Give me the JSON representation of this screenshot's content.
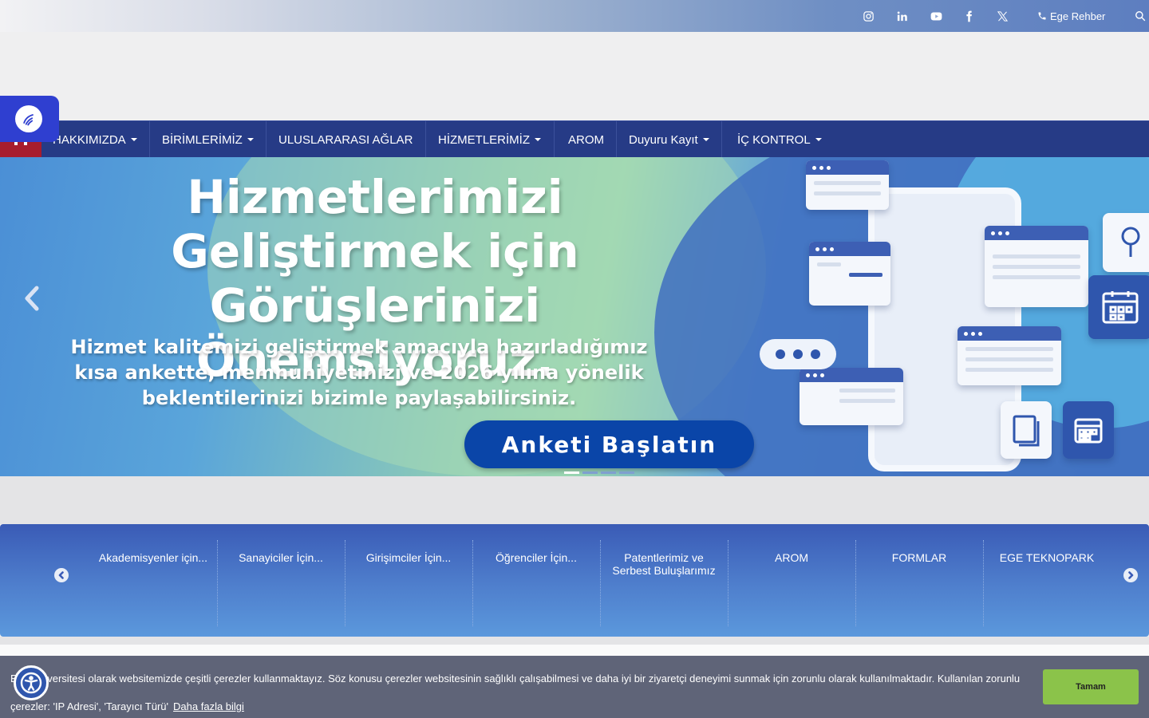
{
  "topbar": {
    "social": [
      {
        "icon": "instagram-icon"
      },
      {
        "icon": "linkedin-icon"
      },
      {
        "icon": "youtube-icon"
      },
      {
        "icon": "facebook-icon"
      },
      {
        "icon": "x-twitter-icon"
      }
    ],
    "rehber_label": "Ege Rehber",
    "search_icon": "search-icon"
  },
  "nav": {
    "items": [
      {
        "label": "HAKKIMIZDA",
        "dropdown": true
      },
      {
        "label": "BİRİMLERİMİZ",
        "dropdown": true
      },
      {
        "label": "ULUSLARARASI AĞLAR",
        "dropdown": false
      },
      {
        "label": "HİZMETLERİMİZ",
        "dropdown": true
      },
      {
        "label": "AROM",
        "dropdown": false
      },
      {
        "label": "Duyuru Kayıt",
        "dropdown": true
      },
      {
        "label": "İÇ KONTROL",
        "dropdown": true
      }
    ]
  },
  "slider": {
    "title": "Hizmetlerimizi Geliştirmek için Görüşlerinizi Önemsiyoruz.",
    "subtitle": "Hizmet kalitemizi geliştirmek amacıyla hazırladığımız kısa ankette, memnuniyetinizi ve 2026 yılına yönelik beklentilerinizi bizimle paylaşabilirsiniz.",
    "cta_label": "Anketi Başlatın",
    "slide_count": 4,
    "active_slide": 1
  },
  "quick_links": [
    "Akademisyenler için...",
    "Sanayiciler İçin...",
    "Girişimciler İçin...",
    "Öğrenciler İçin...",
    "Patentlerimiz ve Serbest Buluşlarımız",
    "AROM",
    "FORMLAR",
    "EGE TEKNOPARK"
  ],
  "cookie": {
    "text": "Ege Üniversitesi olarak websitemizde çeşitli çerezler kullanmaktayız. Söz konusu çerezler websitesinin sağlıklı çalışabilmesi ve daha iyi bir ziyaretçi deneyimi sunmak için zorunlu olarak kullanılmaktadır. Kullanılan zorunlu çerezler: 'IP Adresi', 'Tarayıcı Türü'",
    "more_label": "Daha fazla bilgi",
    "accept_label": "Tamam"
  },
  "colors": {
    "nav_bg": "#263b86",
    "accent_red": "#a71d2e",
    "cta_bg": "#0a45a8",
    "cookie_bg": "#5f6478",
    "cookie_btn": "#8bc34a",
    "accessibility": "#2f3fd0"
  }
}
